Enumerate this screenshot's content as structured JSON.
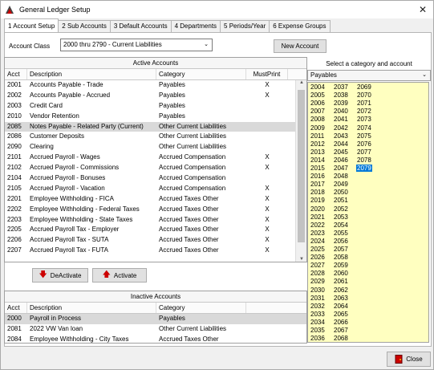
{
  "window": {
    "title": "General Ledger Setup",
    "close_glyph": "✕"
  },
  "tabs": [
    "1 Account Setup",
    "2 Sub Accounts",
    "3 Default Accounts",
    "4 Departments",
    "5 Periods/Year",
    "6 Expense Groups"
  ],
  "account_class": {
    "label": "Account Class",
    "value": "2000 thru 2790 - Current Liabilities"
  },
  "buttons": {
    "new_account": "New Account",
    "deactivate": "DeActivate",
    "activate": "Activate",
    "close": "Close"
  },
  "active": {
    "title": "Active Accounts",
    "headers": [
      "Acct",
      "Description",
      "Category",
      "MustPrint"
    ],
    "rows": [
      [
        "2001",
        "Accounts Payable - Trade",
        "Payables",
        "X"
      ],
      [
        "2002",
        "Accounts Payable - Accrued",
        "Payables",
        "X"
      ],
      [
        "2003",
        "Credit Card",
        "Payables",
        ""
      ],
      [
        "2010",
        "Vendor Retention",
        "Payables",
        ""
      ],
      [
        "2085",
        "Notes Payable - Related Party (Current)",
        "Other Current Liabilities",
        ""
      ],
      [
        "2086",
        "Customer Deposits",
        "Other Current Liabilities",
        ""
      ],
      [
        "2090",
        "Clearing",
        "Other Current Liabilities",
        ""
      ],
      [
        "2101",
        "Accrued Payroll - Wages",
        "Accrued Compensation",
        "X"
      ],
      [
        "2102",
        "Accrued Payroll - Commissions",
        "Accrued Compensation",
        "X"
      ],
      [
        "2104",
        "Accrued Payroll - Bonuses",
        "Accrued Compensation",
        ""
      ],
      [
        "2105",
        "Accrued Payroll - Vacation",
        "Accrued Compensation",
        "X"
      ],
      [
        "2201",
        "Employee Withholding - FICA",
        "Accrued Taxes Other",
        "X"
      ],
      [
        "2202",
        "Employee Withholding - Federal Taxes",
        "Accrued Taxes Other",
        "X"
      ],
      [
        "2203",
        "Employee Withholding - State Taxes",
        "Accrued Taxes Other",
        "X"
      ],
      [
        "2205",
        "Accrued Payroll Tax - Employer",
        "Accrued Taxes Other",
        "X"
      ],
      [
        "2206",
        "Accrued Payroll Tax - SUTA",
        "Accrued Taxes Other",
        "X"
      ],
      [
        "2207",
        "Accrued Payroll Tax - FUTA",
        "Accrued Taxes Other",
        "X"
      ]
    ],
    "selected_row": 4
  },
  "inactive": {
    "title": "Inactive Accounts",
    "headers": [
      "Acct",
      "Description",
      "Category"
    ],
    "rows": [
      [
        "2000",
        "Payroll in Process",
        "Payables"
      ],
      [
        "2081",
        "2022 VW Van loan",
        "Other Current Liabilities"
      ],
      [
        "2084",
        "Employee Withholding - City Taxes",
        "Accrued Taxes Other"
      ]
    ],
    "selected_row": 0
  },
  "category_picker": {
    "title": "Select a category and account",
    "selected_category": "Payables",
    "columns": [
      [
        "2004",
        "2005",
        "2006",
        "2007",
        "2008",
        "2009",
        "2011",
        "2012",
        "2013",
        "2014",
        "2015",
        "2016",
        "2017",
        "2018",
        "2019",
        "2020",
        "2021",
        "2022",
        "2023",
        "2024",
        "2025",
        "2026",
        "2027",
        "2028",
        "2029",
        "2030",
        "2031",
        "2032",
        "2033",
        "2034",
        "2035",
        "2036"
      ],
      [
        "2037",
        "2038",
        "2039",
        "2040",
        "2041",
        "2042",
        "2043",
        "2044",
        "2045",
        "2046",
        "2047",
        "2048",
        "2049",
        "2050",
        "2051",
        "2052",
        "2053",
        "2054",
        "2055",
        "2056",
        "2057",
        "2058",
        "2059",
        "2060",
        "2061",
        "2062",
        "2063",
        "2064",
        "2065",
        "2066",
        "2067",
        "2068"
      ],
      [
        "2069",
        "2070",
        "2071",
        "2072",
        "2073",
        "2074",
        "2075",
        "2076",
        "2077",
        "2078",
        "2079"
      ]
    ],
    "selected_code": "2079"
  }
}
